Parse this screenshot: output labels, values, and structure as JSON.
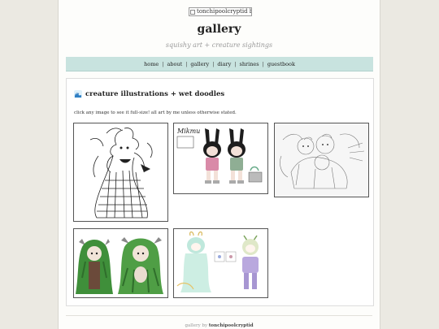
{
  "banner": {
    "alt_text": "tonchipoolcryptid banner"
  },
  "header": {
    "title": "gallery",
    "subtitle": "squishy art + creature sightings"
  },
  "nav": {
    "items": [
      "home",
      "about",
      "gallery",
      "diary",
      "shrines",
      "guestbook"
    ],
    "separator": "|"
  },
  "section": {
    "heading": "creature illustrations + wet doodles",
    "heading_icon": "wave-icon",
    "description": "click any image to see it full-size! all art by me unless otherwise stated."
  },
  "gallery": {
    "items": [
      {
        "name": "lineart-creature-dress"
      },
      {
        "name": "mikmu-bunny-duo",
        "caption": "Mikmu"
      },
      {
        "name": "sketch-creature-group"
      },
      {
        "name": "green-leaf-creatures"
      },
      {
        "name": "pastel-creature-characters"
      }
    ]
  },
  "footer": {
    "prefix": "gallery by",
    "author": "tonchipoolcryptid"
  },
  "colors": {
    "nav_bg": "#c8e3df",
    "page_bg": "#ebe9e2",
    "card_bg": "#ffffff"
  }
}
